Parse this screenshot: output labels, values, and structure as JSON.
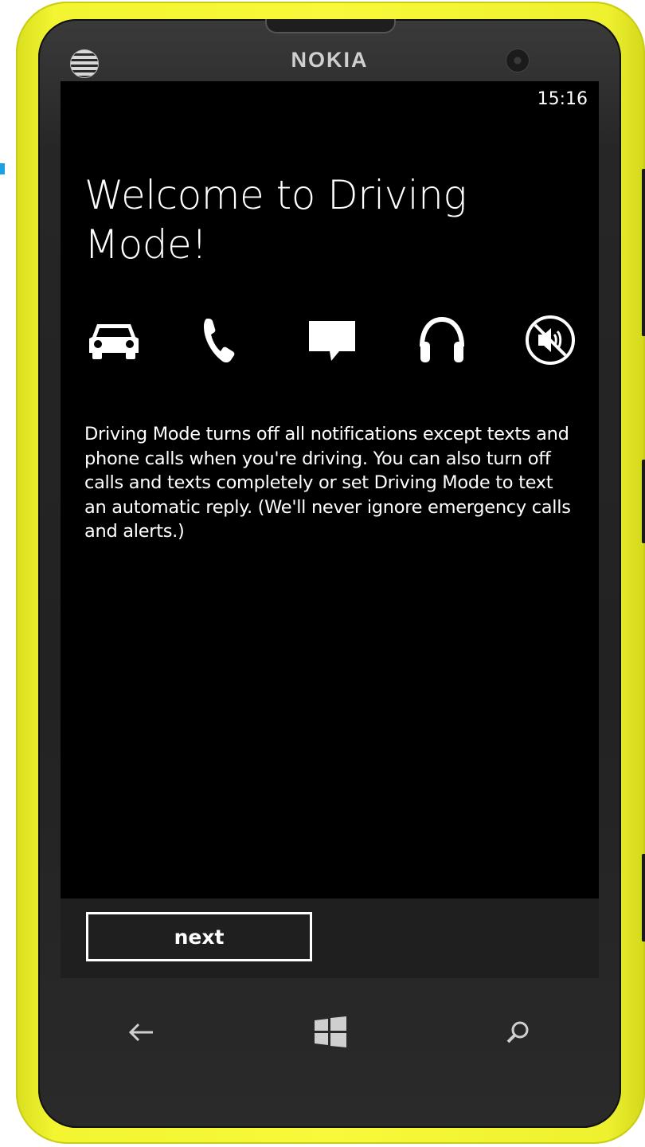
{
  "device": {
    "brand": "NOKIA"
  },
  "status_bar": {
    "time": "15:16"
  },
  "page": {
    "title": "Welcome to Driving Mode!",
    "description": "Driving Mode turns off all notifications except texts and phone calls when you're driving. You can also turn off calls and texts completely or set Driving Mode to text an automatic reply. (We'll never ignore emergency calls and alerts.)",
    "feature_icons": [
      "car-icon",
      "phone-icon",
      "message-icon",
      "headphones-icon",
      "mute-icon"
    ]
  },
  "app_bar": {
    "next_label": "next"
  },
  "nav_bar": {
    "buttons": [
      "back-icon",
      "windows-start-icon",
      "search-icon"
    ]
  },
  "colors": {
    "phone_body": "#f7f93a",
    "screen_background": "#000000",
    "text": "#ffffff",
    "app_bar": "#1f1f1f",
    "accent": "#1ba1e2"
  }
}
